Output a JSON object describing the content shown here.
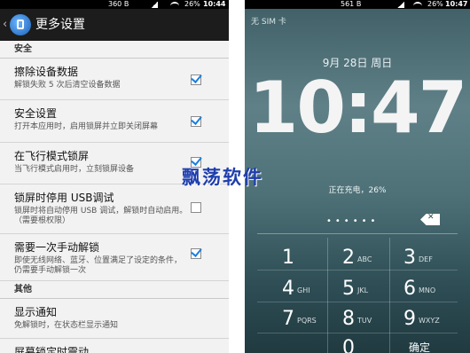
{
  "left": {
    "status": {
      "speed": "360 B",
      "battery": "26%",
      "time": "10:44"
    },
    "title": "更多设置",
    "sections": [
      {
        "label": "安全"
      },
      {
        "label": "其他"
      }
    ],
    "rows": [
      {
        "title": "擦除设备数据",
        "subtitle": "解锁失败 5 次后清空设备数据",
        "checked": true
      },
      {
        "title": "安全设置",
        "subtitle": "打开本应用时，启用锁屏并立即关闭屏幕",
        "checked": true
      },
      {
        "title": "在飞行模式锁屏",
        "subtitle": "当飞行模式启用时，立刻锁屏设备",
        "checked": true
      },
      {
        "title": "锁屏时停用 USB调试",
        "subtitle": "锁屏时将自动停用 USB 调试，解锁时自动启用。（需要根权限）",
        "checked": false
      },
      {
        "title": "需要一次手动解锁",
        "subtitle": "即使无线网络、蓝牙、位置满足了设定的条件，仍需要手动解锁一次",
        "checked": true
      },
      {
        "title": "显示通知",
        "subtitle": "免解锁时，在状态栏显示通知"
      },
      {
        "title": "屏幕锁定时震动"
      }
    ]
  },
  "watermark": "飘荡软件",
  "right": {
    "status": {
      "speed": "561 B",
      "battery": "26%",
      "time": "10:47"
    },
    "carrier": "无 SIM 卡",
    "date": "9月 28日 周日",
    "clock": "10:47",
    "charging": "正在充电，26%",
    "pin_dots": "••••••",
    "keys": [
      {
        "digit": "1",
        "letters": ""
      },
      {
        "digit": "2",
        "letters": "ABC"
      },
      {
        "digit": "3",
        "letters": "DEF"
      },
      {
        "digit": "4",
        "letters": "GHI"
      },
      {
        "digit": "5",
        "letters": "JKL"
      },
      {
        "digit": "6",
        "letters": "MNO"
      },
      {
        "digit": "7",
        "letters": "PQRS"
      },
      {
        "digit": "8",
        "letters": "TUV"
      },
      {
        "digit": "9",
        "letters": "WXYZ"
      },
      {
        "digit": "0",
        "letters": ""
      }
    ],
    "confirm": "确定"
  }
}
